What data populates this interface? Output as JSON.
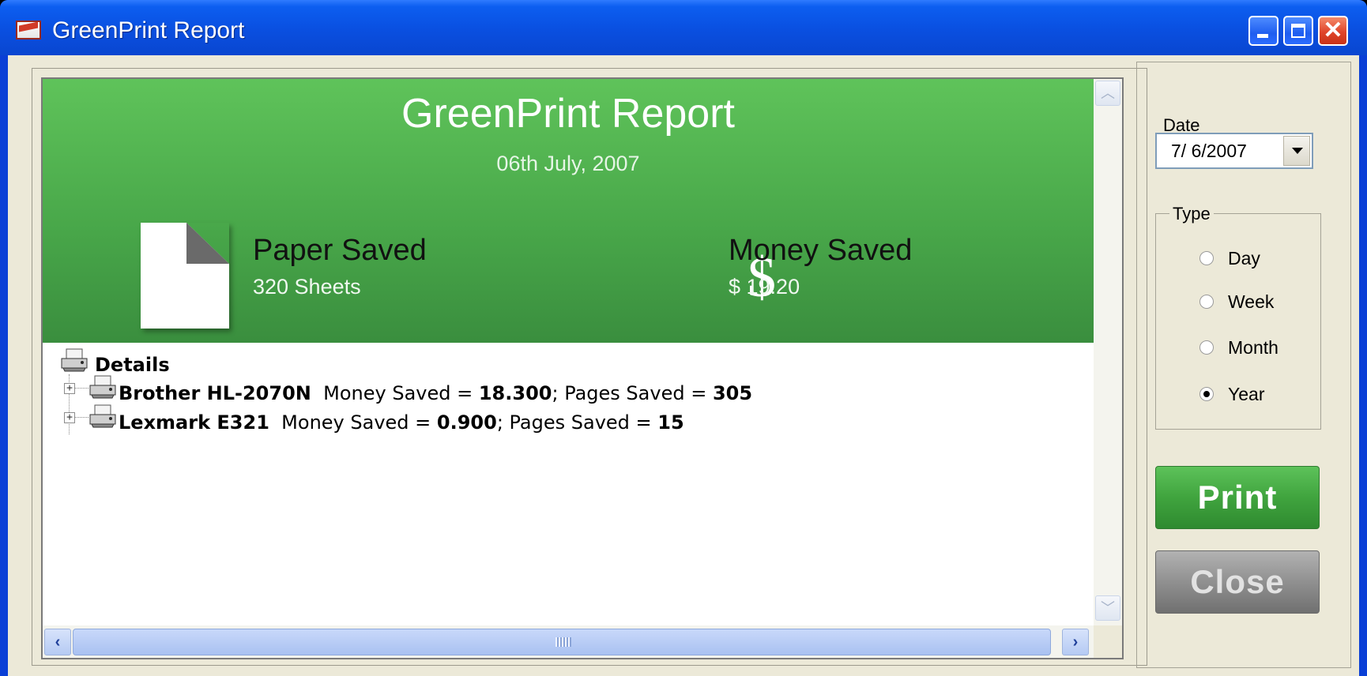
{
  "window": {
    "title": "GreenPrint Report",
    "controls": {
      "minimize": "minimize-icon",
      "maximize": "maximize-icon",
      "close": "close-icon"
    }
  },
  "report": {
    "title": "GreenPrint Report",
    "date": "06th July, 2007",
    "paper": {
      "title": "Paper Saved",
      "value": "320 Sheets",
      "icon": "paper-icon"
    },
    "money": {
      "title": "Money Saved",
      "value": "$ 19.20",
      "icon": "dollar-icon",
      "symbol": "$"
    },
    "details": {
      "heading": "Details",
      "rows": [
        {
          "printer": "Brother HL-2070N",
          "money_label": "Money Saved = ",
          "money_value": "18.300",
          "pages_label": "; Pages Saved = ",
          "pages_value": "305"
        },
        {
          "printer": "Lexmark E321",
          "money_label": "Money Saved = ",
          "money_value": "0.900",
          "pages_label": "; Pages Saved = ",
          "pages_value": "15"
        }
      ]
    }
  },
  "sidebar": {
    "date_label": "Date",
    "date_value": "7/ 6/2007",
    "type_label": "Type",
    "type_options": [
      {
        "label": "Day",
        "checked": false
      },
      {
        "label": "Week",
        "checked": false
      },
      {
        "label": "Month",
        "checked": false
      },
      {
        "label": "Year",
        "checked": true
      }
    ],
    "print_label": "Print",
    "close_label": "Close"
  },
  "colors": {
    "banner_green": "#49a84a",
    "print_button": "#40a43e",
    "close_button": "#909090",
    "titlebar_blue": "#0a4fe0"
  }
}
